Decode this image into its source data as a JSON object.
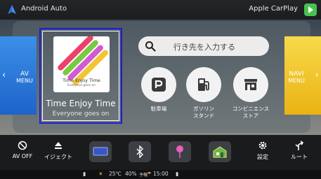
{
  "top_bar": {
    "android_auto_label": "Android Auto",
    "carplay_label": "Apple CarPlay"
  },
  "av_menu": {
    "line1": "AV",
    "line2": "MENU",
    "arrow": "‹"
  },
  "navi_menu": {
    "line1": "NAVI",
    "line2": "MENU",
    "arrow": "›"
  },
  "media": {
    "art_title": "Time Enjoy Time",
    "art_subtitle": "Everyone goes on",
    "title": "Time Enjoy Time",
    "artist": "Everyone goes on"
  },
  "search": {
    "placeholder": "行き先を入力する"
  },
  "poi": [
    {
      "label_line1": "駐車場",
      "label_line2": "",
      "icon": "parking-icon"
    },
    {
      "label_line1": "ガソリン",
      "label_line2": "スタンド",
      "icon": "gas-station-icon"
    },
    {
      "label_line1": "コンビニエンス",
      "label_line2": "ストア",
      "icon": "convenience-store-icon"
    }
  ],
  "dock": {
    "av_off_label": "AV OFF",
    "eject_label": "イジェクト",
    "settings_label": "設定",
    "route_label": "ルート"
  },
  "status": {
    "temperature": "25℃",
    "humidity": "40%",
    "forecast": "予報",
    "time": "15:00"
  },
  "colors": {
    "av_tab": "#2f7fe0",
    "navi_tab": "#f2c92e",
    "carplay_green": "#49c14f",
    "focus_border": "#1b1fd6"
  }
}
